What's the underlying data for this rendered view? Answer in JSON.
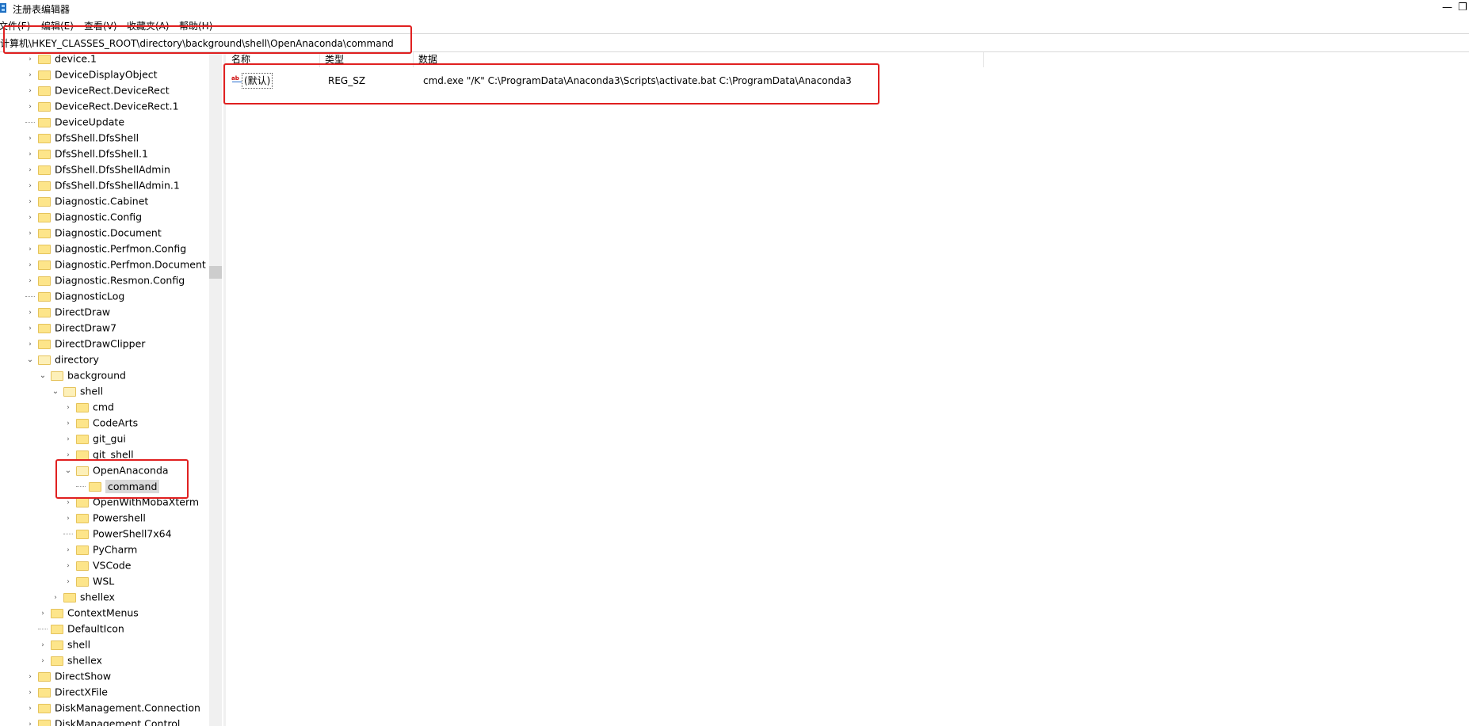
{
  "window": {
    "title": "注册表编辑器",
    "minimize_glyph": "—",
    "restore_glyph": "❐"
  },
  "menu": [
    {
      "label": "文件(F)"
    },
    {
      "label": "编辑(E)"
    },
    {
      "label": "查看(V)"
    },
    {
      "label": "收藏夹(A)"
    },
    {
      "label": "帮助(H)"
    }
  ],
  "address": {
    "path": "计算机\\HKEY_CLASSES_ROOT\\directory\\background\\shell\\OpenAnaconda\\command"
  },
  "tree": {
    "items": [
      {
        "label": "device.1",
        "level": 0,
        "state": "collapsed"
      },
      {
        "label": "DeviceDisplayObject",
        "level": 0,
        "state": "collapsed"
      },
      {
        "label": "DeviceRect.DeviceRect",
        "level": 0,
        "state": "collapsed"
      },
      {
        "label": "DeviceRect.DeviceRect.1",
        "level": 0,
        "state": "collapsed"
      },
      {
        "label": "DeviceUpdate",
        "level": 0,
        "state": "leaf"
      },
      {
        "label": "DfsShell.DfsShell",
        "level": 0,
        "state": "collapsed"
      },
      {
        "label": "DfsShell.DfsShell.1",
        "level": 0,
        "state": "collapsed"
      },
      {
        "label": "DfsShell.DfsShellAdmin",
        "level": 0,
        "state": "collapsed"
      },
      {
        "label": "DfsShell.DfsShellAdmin.1",
        "level": 0,
        "state": "collapsed"
      },
      {
        "label": "Diagnostic.Cabinet",
        "level": 0,
        "state": "collapsed"
      },
      {
        "label": "Diagnostic.Config",
        "level": 0,
        "state": "collapsed"
      },
      {
        "label": "Diagnostic.Document",
        "level": 0,
        "state": "collapsed"
      },
      {
        "label": "Diagnostic.Perfmon.Config",
        "level": 0,
        "state": "collapsed"
      },
      {
        "label": "Diagnostic.Perfmon.Document",
        "level": 0,
        "state": "collapsed"
      },
      {
        "label": "Diagnostic.Resmon.Config",
        "level": 0,
        "state": "collapsed"
      },
      {
        "label": "DiagnosticLog",
        "level": 0,
        "state": "leaf"
      },
      {
        "label": "DirectDraw",
        "level": 0,
        "state": "collapsed"
      },
      {
        "label": "DirectDraw7",
        "level": 0,
        "state": "collapsed"
      },
      {
        "label": "DirectDrawClipper",
        "level": 0,
        "state": "collapsed"
      },
      {
        "label": "directory",
        "level": 0,
        "state": "expanded"
      },
      {
        "label": "background",
        "level": 1,
        "state": "expanded"
      },
      {
        "label": "shell",
        "level": 2,
        "state": "expanded"
      },
      {
        "label": "cmd",
        "level": 3,
        "state": "collapsed"
      },
      {
        "label": "CodeArts",
        "level": 3,
        "state": "collapsed"
      },
      {
        "label": "git_gui",
        "level": 3,
        "state": "collapsed"
      },
      {
        "label": "git_shell",
        "level": 3,
        "state": "collapsed"
      },
      {
        "label": "OpenAnaconda",
        "level": 3,
        "state": "expanded"
      },
      {
        "label": "command",
        "level": 4,
        "state": "selected"
      },
      {
        "label": "OpenWithMobaXterm",
        "level": 3,
        "state": "collapsed"
      },
      {
        "label": "Powershell",
        "level": 3,
        "state": "collapsed"
      },
      {
        "label": "PowerShell7x64",
        "level": 3,
        "state": "leaf"
      },
      {
        "label": "PyCharm",
        "level": 3,
        "state": "collapsed"
      },
      {
        "label": "VSCode",
        "level": 3,
        "state": "collapsed"
      },
      {
        "label": "WSL",
        "level": 3,
        "state": "collapsed"
      },
      {
        "label": "shellex",
        "level": 2,
        "state": "collapsed"
      },
      {
        "label": "ContextMenus",
        "level": 1,
        "state": "collapsed"
      },
      {
        "label": "DefaultIcon",
        "level": 1,
        "state": "leaf"
      },
      {
        "label": "shell",
        "level": 1,
        "state": "collapsed"
      },
      {
        "label": "shellex",
        "level": 1,
        "state": "collapsed"
      },
      {
        "label": "DirectShow",
        "level": 0,
        "state": "collapsed"
      },
      {
        "label": "DirectXFile",
        "level": 0,
        "state": "collapsed"
      },
      {
        "label": "DiskManagement.Connection",
        "level": 0,
        "state": "collapsed"
      },
      {
        "label": "DiskManagement.Control",
        "level": 0,
        "state": "collapsed"
      }
    ]
  },
  "list": {
    "columns": [
      "名称",
      "类型",
      "数据"
    ],
    "rows": [
      {
        "name": "(默认)",
        "type": "REG_SZ",
        "data": "cmd.exe \"/K\" C:\\ProgramData\\Anaconda3\\Scripts\\activate.bat C:\\ProgramData\\Anaconda3"
      }
    ]
  },
  "icons": {
    "app": "registry-app-icon",
    "value": "string-value-ab-icon",
    "folder": "folder-icon"
  },
  "colors": {
    "highlight_box": "#e02020",
    "folder": "#fde58a",
    "selection": "#d9d9d9"
  }
}
